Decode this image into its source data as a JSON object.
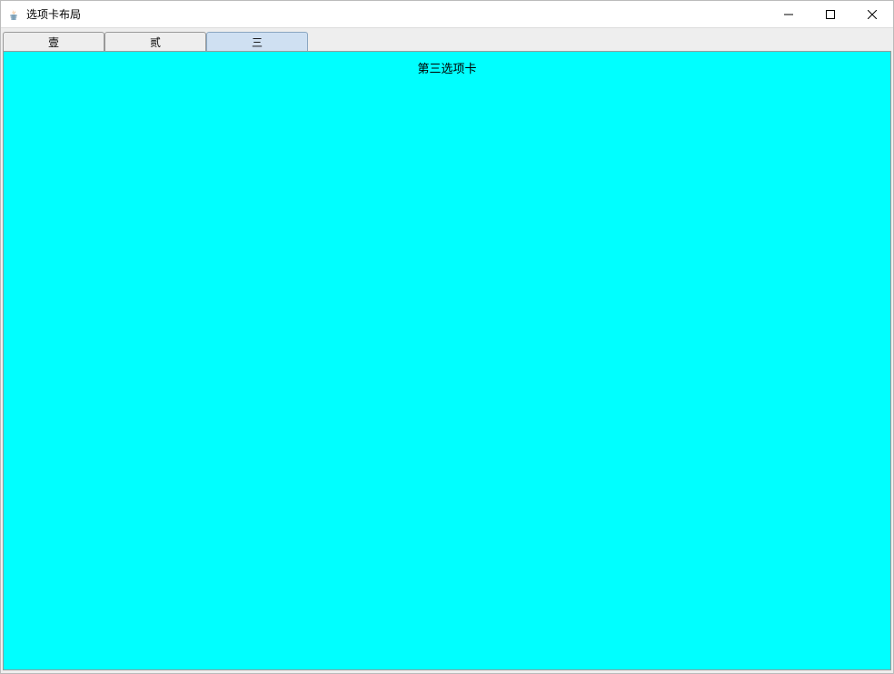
{
  "window": {
    "title": "选项卡布局"
  },
  "tabs": [
    {
      "label": "壹",
      "active": false
    },
    {
      "label": "贰",
      "active": false
    },
    {
      "label": "三",
      "active": true
    }
  ],
  "content": {
    "heading": "第三选项卡",
    "background_color": "#00ffff"
  }
}
